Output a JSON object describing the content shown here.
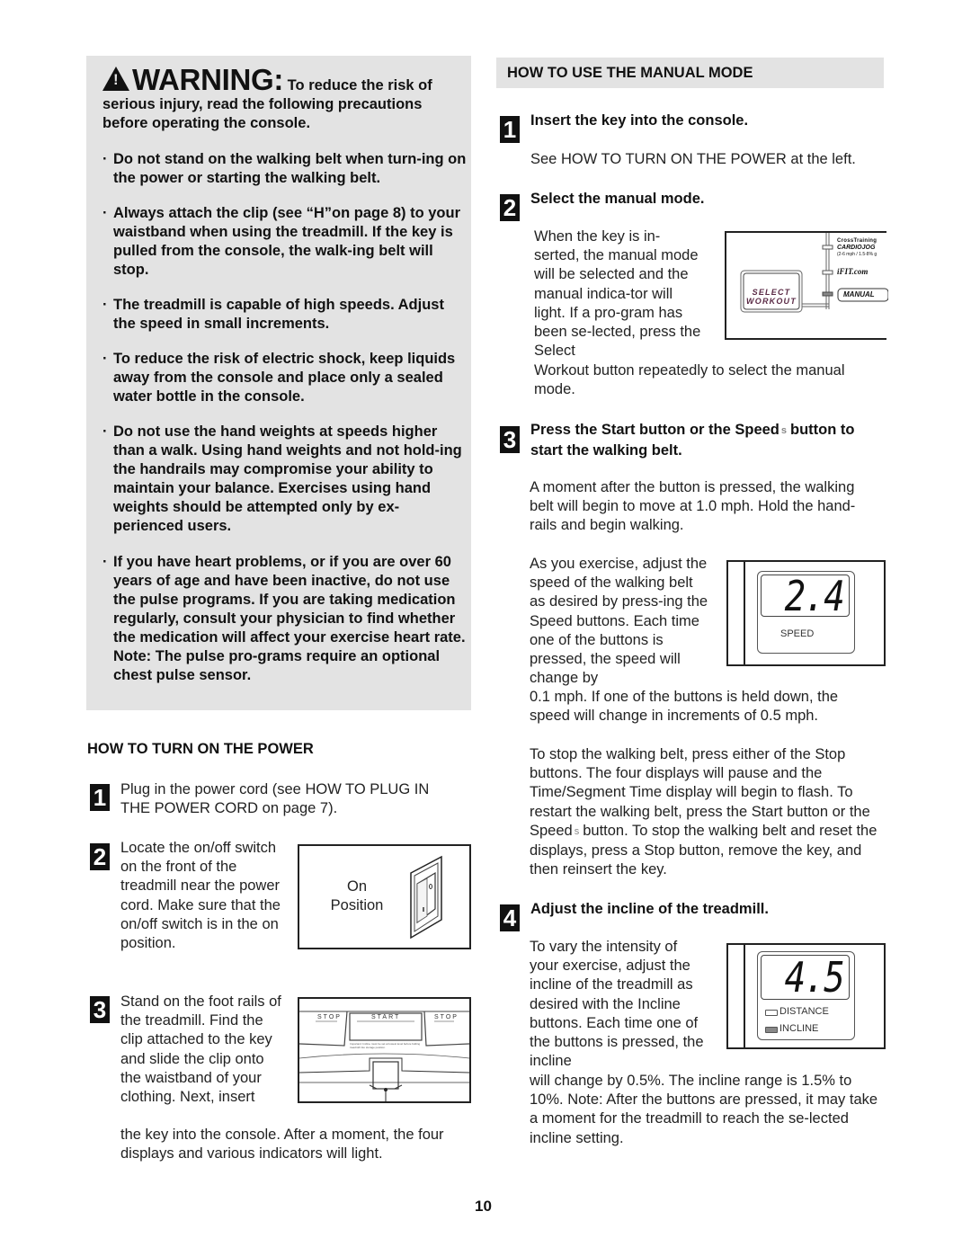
{
  "warning": {
    "label": "WARNING:",
    "intro_first": " To reduce the risk of",
    "intro_rest": "serious injury, read the following precautions before operating the console.",
    "bullet_char": "·",
    "bullets": [
      "Do not stand on the walking belt when turn-ing on the power or starting the walking belt.",
      "Always attach the clip (see “H”on page 8) to your waistband when using the treadmill. If the key is pulled from the console, the walk-ing belt will stop.",
      "The treadmill is capable of high speeds. Adjust the speed in small increments.",
      "To reduce the risk of electric shock, keep liquids away from the console and place only a sealed water bottle in the console.",
      "Do not use the hand weights at speeds higher than a walk. Using hand weights and not hold-ing the handrails may compromise your ability to maintain your balance. Exercises using hand weights should be attempted only by ex-perienced users.",
      "If you have heart problems, or if you are over 60 years of age and have been inactive, do not use the pulse programs. If you are taking medication regularly, consult your physician to find whether the medication will affect your exercise heart rate. Note: The pulse pro-grams require an optional chest pulse sensor."
    ]
  },
  "power": {
    "heading": "HOW TO TURN ON THE POWER",
    "steps": [
      {
        "num": "1",
        "text": "Plug in the power cord (see HOW TO PLUG IN THE POWER CORD on page 7)."
      },
      {
        "num": "2",
        "text": "Locate the on/off switch on the front of the treadmill near the power cord. Make sure that the on/off switch is in the on position."
      },
      {
        "num": "3",
        "text": "Stand on the foot rails of the treadmill. Find the clip attached to the key and slide the clip onto the waistband of your clothing. Next, insert",
        "text_cont": "the key into the console. After a moment, the four displays and various indicators will light."
      }
    ],
    "switch_figure": {
      "label_line1": "On",
      "label_line2": "Position"
    },
    "console_figure": {
      "stop_left": "STOP",
      "start": "START",
      "stop_right": "STOP",
      "note": "Important: Incline must be set at lowest level before folding treadmill into storage position."
    }
  },
  "manual": {
    "heading": "HOW TO USE THE MANUAL MODE",
    "step1": {
      "num": "1",
      "title": "Insert the key into the console.",
      "text": "See HOW TO TURN ON THE POWER at the left."
    },
    "step2": {
      "num": "2",
      "title": "Select the manual mode.",
      "text": "When the key is in-serted, the manual mode will be selected and the manual indica-tor will light. If a pro-gram has been se-lected, press the Select",
      "text_cont": "Workout button repeatedly to select the manual mode."
    },
    "step2_figure": {
      "select_line1": "SELECT",
      "select_line2": "WORKOUT",
      "crosstraining": "CrossTraining",
      "cardiojog": "CARDIOJOG",
      "cardiojog_sub": "(2-6 mph / 1.5-8% g",
      "ifit": "iFIT.com",
      "manual": "MANUAL"
    },
    "step3": {
      "num": "3",
      "title_a": "Press the Start button or the Speed",
      "speed_symbol": "s",
      "title_b": "button to start the walking belt.",
      "p1": "A moment after the button is pressed, the walking belt will begin to move at 1.0 mph. Hold the hand-rails and begin walking.",
      "p2": "As you exercise, adjust the speed of the walking belt as desired by press-ing the Speed buttons. Each time one of the buttons is pressed, the speed will change by",
      "p2_cont": "0.1 mph. If one of the buttons is held down, the speed will change in increments of 0.5 mph.",
      "p3_a": "To stop the walking belt, press either of the Stop buttons. The four displays will pause and the Time/Segment Time display will begin to flash. To restart the walking belt, press the Start button or the Speed",
      "p3_b": "button. To stop the walking belt and reset the displays, press a Stop button, remove the key, and then reinsert the key."
    },
    "speed_display": {
      "value": "2.4",
      "label": "SPEED"
    },
    "step4": {
      "num": "4",
      "title": "Adjust the incline of the treadmill.",
      "text": "To vary the intensity of your exercise, adjust the incline of the treadmill as desired with the Incline buttons. Each time one of the buttons is pressed, the incline",
      "text_cont": "will change by 0.5%. The incline range is 1.5% to 10%. Note: After the buttons are pressed, it may take a moment for the treadmill to reach the se-lected incline setting."
    },
    "incline_display": {
      "value": "4.5",
      "label_distance": "DISTANCE",
      "label_incline": "INCLINE"
    }
  },
  "page_number": "10"
}
